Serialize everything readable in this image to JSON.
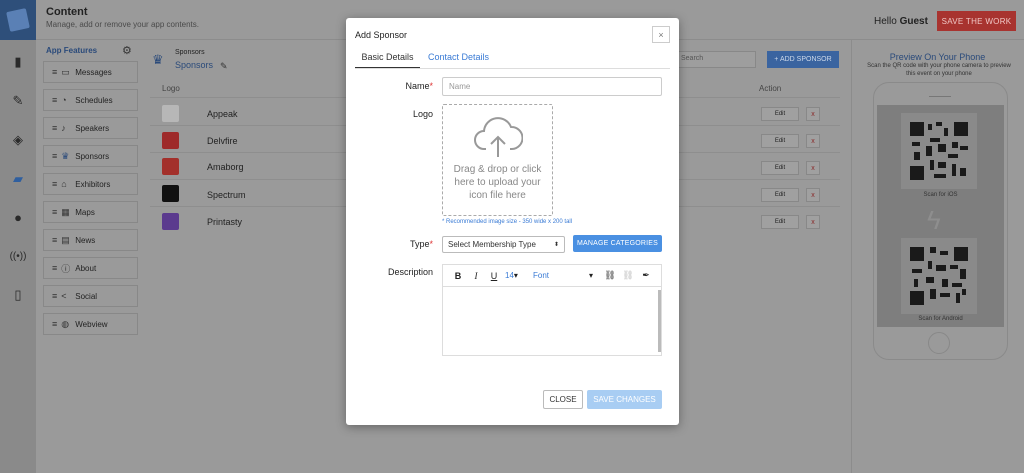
{
  "header": {
    "title": "Content",
    "subtitle": "Manage, add or remove your app contents.",
    "greeting": "Hello",
    "user": "Guest",
    "save_label": "SAVE THE WORK"
  },
  "rail_icons": [
    "document-icon",
    "brush-icon",
    "layers-icon",
    "folder-icon",
    "user-icon",
    "broadcast-icon",
    "phone-icon"
  ],
  "features": {
    "title": "App Features",
    "items": [
      {
        "label": "Messages",
        "icon": "messages-icon",
        "glyph": "▭"
      },
      {
        "label": "Schedules",
        "icon": "clock-icon",
        "glyph": "◔"
      },
      {
        "label": "Speakers",
        "icon": "microphone-icon",
        "glyph": "♪"
      },
      {
        "label": "Sponsors",
        "icon": "crown-icon",
        "glyph": "♛"
      },
      {
        "label": "Exhibitors",
        "icon": "store-icon",
        "glyph": "⌂"
      },
      {
        "label": "Maps",
        "icon": "map-icon",
        "glyph": "▦"
      },
      {
        "label": "News",
        "icon": "news-icon",
        "glyph": "▤"
      },
      {
        "label": "About",
        "icon": "info-icon",
        "glyph": "ⓘ"
      },
      {
        "label": "Social",
        "icon": "share-icon",
        "glyph": "<"
      },
      {
        "label": "Webview",
        "icon": "globe-icon",
        "glyph": "◍"
      }
    ]
  },
  "sponsors_panel": {
    "small_title": "Sponsors",
    "title": "Sponsors",
    "search_placeholder": "Search",
    "add_label": "+ ADD SPONSOR",
    "col_logo": "Logo",
    "col_action": "Action",
    "rows": [
      {
        "name": "Appeak",
        "color": "#b7b7b7",
        "edit": "Edit",
        "delete": "x"
      },
      {
        "name": "Delvfire",
        "color": "#9e2a2a",
        "edit": "Edit",
        "delete": "x"
      },
      {
        "name": "Amaborg",
        "color": "#a3302b",
        "edit": "Edit",
        "delete": "x"
      },
      {
        "name": "Spectrum",
        "color": "#111111",
        "edit": "Edit",
        "delete": "x"
      },
      {
        "name": "Printasty",
        "color": "#5b3a8e",
        "edit": "Edit",
        "delete": "x"
      }
    ]
  },
  "preview": {
    "title": "Preview On Your Phone",
    "subtitle": "Scan the QR code with your phone camera to preview this event on your phone",
    "ios_caption": "Scan for iOS",
    "android_caption": "Scan for Android"
  },
  "modal": {
    "title": "Add Sponsor",
    "close_glyph": "×",
    "tabs": [
      "Basic Details",
      "Contact Details"
    ],
    "name_label": "Name",
    "name_placeholder": "Name",
    "logo_label": "Logo",
    "upload_text": "Drag & drop or click here to upload your icon file here",
    "upload_note": "* Recommended image size - 350 wide x 200 tall",
    "type_label": "Type",
    "type_value": "Select Membership Type",
    "manage_label": "MANAGE CATEGORIES",
    "description_label": "Description",
    "toolbar": {
      "bold": "B",
      "italic": "I",
      "underline": "U",
      "size": "14",
      "font": "Font"
    },
    "close_label": "CLOSE",
    "save_label": "SAVE CHANGES"
  }
}
